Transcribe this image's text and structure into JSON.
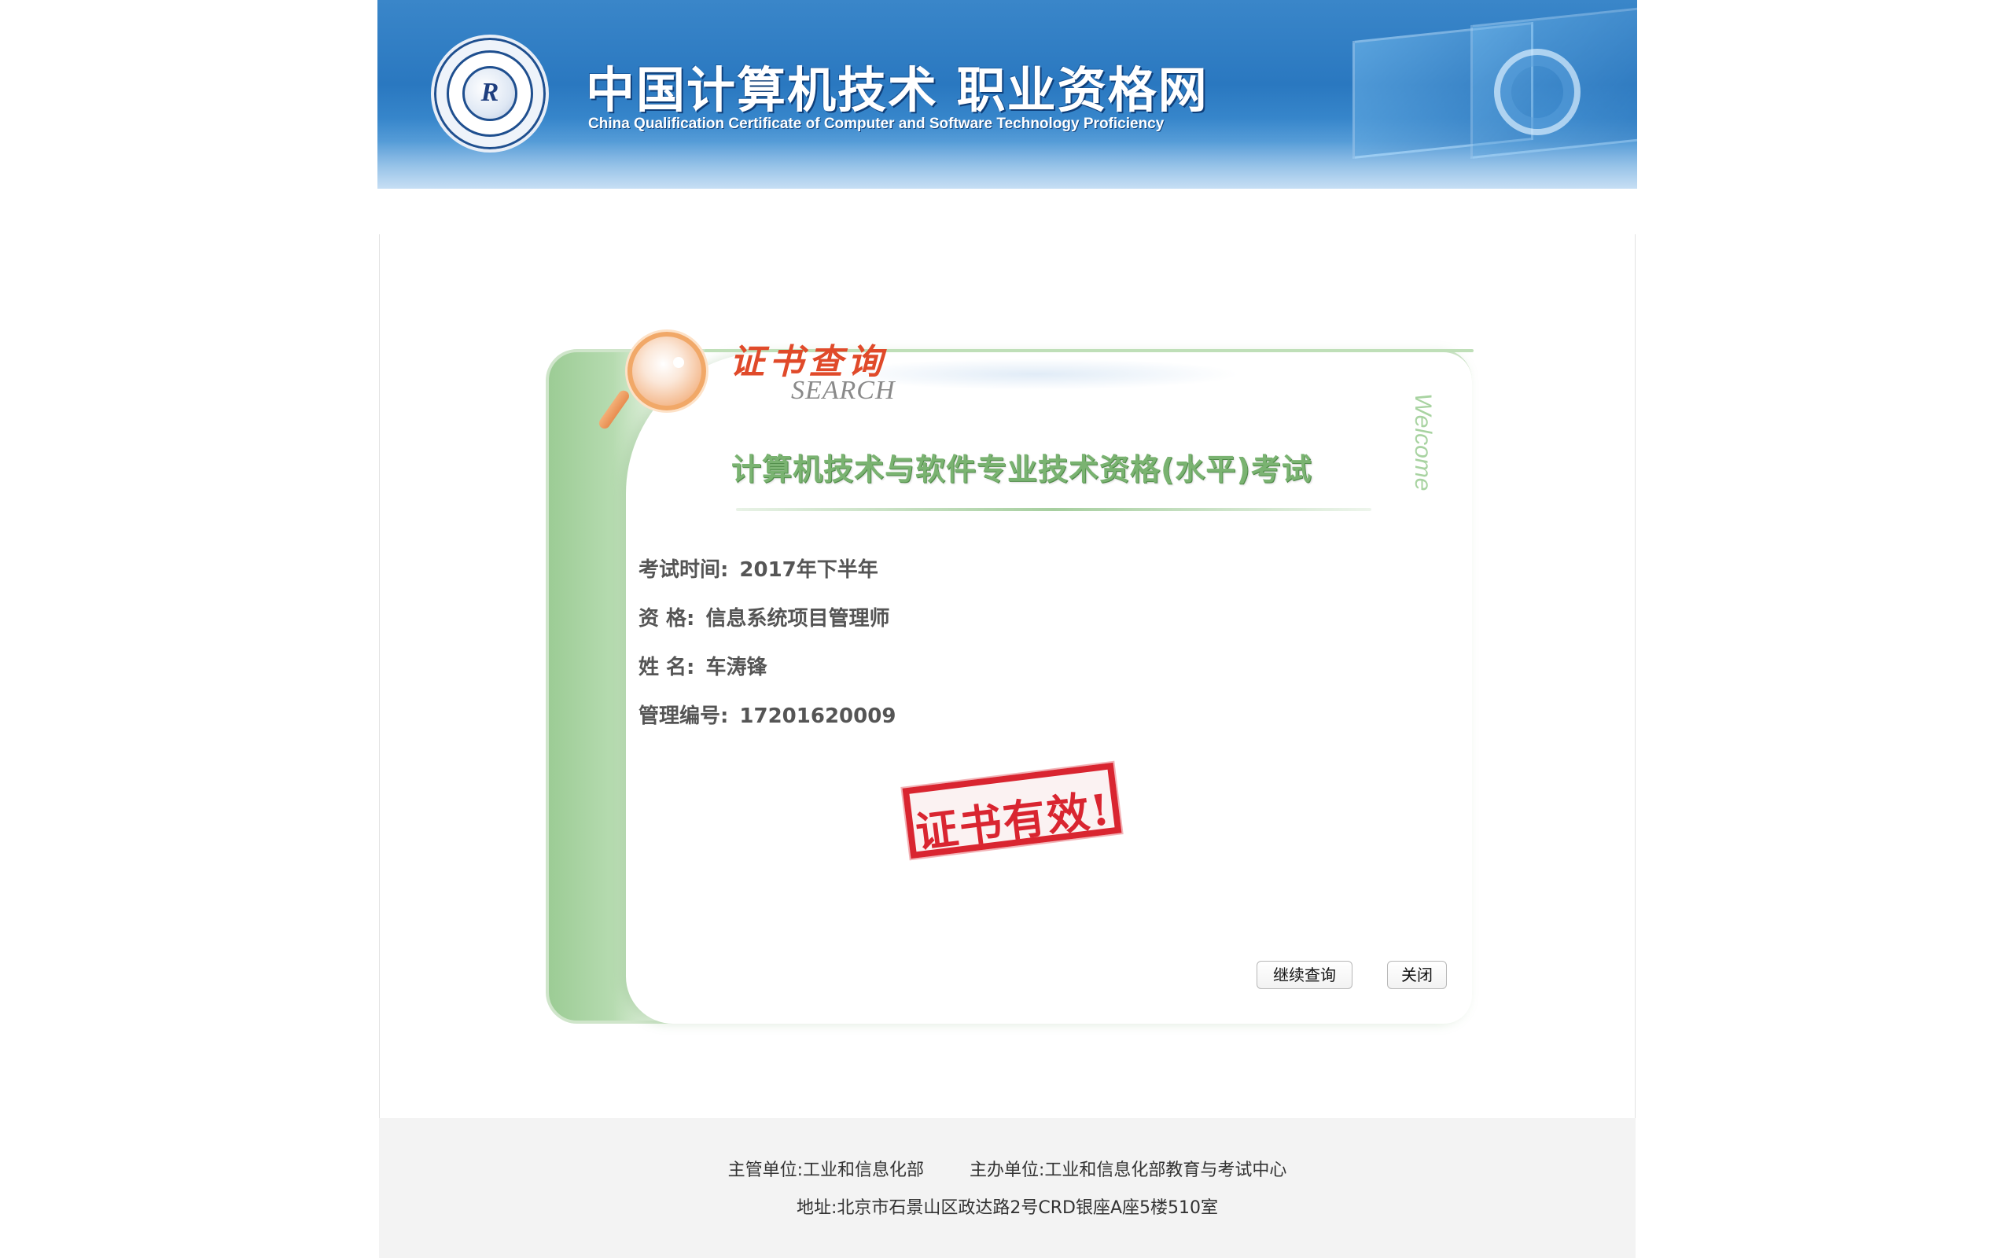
{
  "header": {
    "logo_icon": "certificate-seal-logo",
    "logo_glyph": "R",
    "title": "中国计算机技术 职业资格网",
    "subtitle": "China Qualification Certificate of Computer and Software Technology Proficiency"
  },
  "card": {
    "search_cn": "证书查询",
    "search_en": "SEARCH",
    "welcome": "Welcome",
    "exam_title": "计算机技术与软件专业技术资格(水平)考试",
    "fields": {
      "exam_time_label": "考试时间:",
      "exam_time_value": "2017年下半年",
      "qualification_label": "资 格:",
      "qualification_value": "信息系统项目管理师",
      "name_label": "姓 名:",
      "name_value": "车涛锋",
      "management_id_label": "管理编号:",
      "management_id_value": "17201620009"
    },
    "stamp_text": "证书有效!",
    "buttons": {
      "continue_label": "继续查询",
      "close_label": "关闭"
    }
  },
  "footer": {
    "supervisor": "主管单位:工业和信息化部",
    "organizer": "主办单位:工业和信息化部教育与考试中心",
    "address": "地址:北京市石景山区政达路2号CRD银座A座5楼510室"
  },
  "colors": {
    "banner_blue": "#2a78c0",
    "card_green": "#9ccc95",
    "title_green": "#7ab371",
    "search_red": "#e04a2a",
    "stamp_red": "#d92530"
  }
}
